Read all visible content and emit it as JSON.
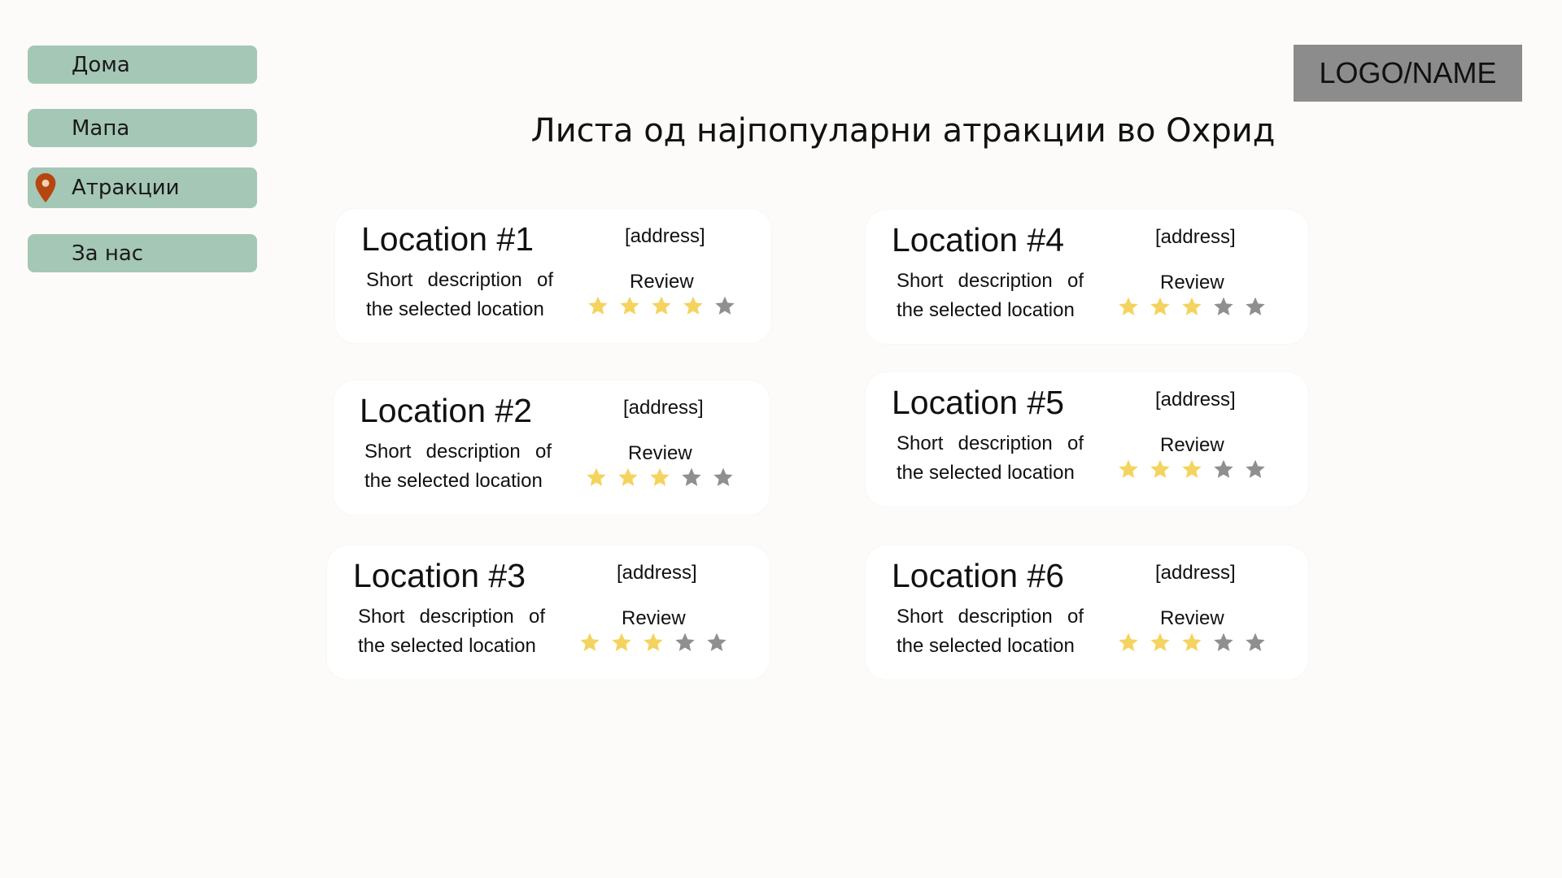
{
  "sidebar": {
    "items": [
      {
        "label": "Дома",
        "active": false
      },
      {
        "label": "Мапа",
        "active": false
      },
      {
        "label": "Атракции",
        "active": true,
        "icon": "map-pin-icon"
      },
      {
        "label": "За нас",
        "active": false
      }
    ]
  },
  "header": {
    "logo": "LOGO/NAME",
    "title": "Листа од најпопуларни атракции во Охрид"
  },
  "colors": {
    "nav_bg": "#a5c7b6",
    "pin": "#b5460f",
    "star_filled": "#f4d35e",
    "star_empty": "#8f8f8f",
    "logo_bg": "#8c8c8c"
  },
  "locations": [
    {
      "title": "Location #1",
      "address": "[address]",
      "desc_line1": "Short description of",
      "desc_line2": "the selected location",
      "review_label": "Review",
      "rating": 4,
      "max_rating": 5
    },
    {
      "title": "Location #2",
      "address": "[address]",
      "desc_line1": "Short description of",
      "desc_line2": "the selected location",
      "review_label": "Review",
      "rating": 3,
      "max_rating": 5
    },
    {
      "title": "Location #3",
      "address": "[address]",
      "desc_line1": "Short description of",
      "desc_line2": "the selected location",
      "review_label": "Review",
      "rating": 3,
      "max_rating": 5
    },
    {
      "title": "Location #4",
      "address": "[address]",
      "desc_line1": "Short description of",
      "desc_line2": "the selected location",
      "review_label": "Review",
      "rating": 3,
      "max_rating": 5
    },
    {
      "title": "Location #5",
      "address": "[address]",
      "desc_line1": "Short description of",
      "desc_line2": "the selected location",
      "review_label": "Review",
      "rating": 3,
      "max_rating": 5
    },
    {
      "title": "Location #6",
      "address": "[address]",
      "desc_line1": "Short description of",
      "desc_line2": "the selected location",
      "review_label": "Review",
      "rating": 3,
      "max_rating": 5
    }
  ]
}
